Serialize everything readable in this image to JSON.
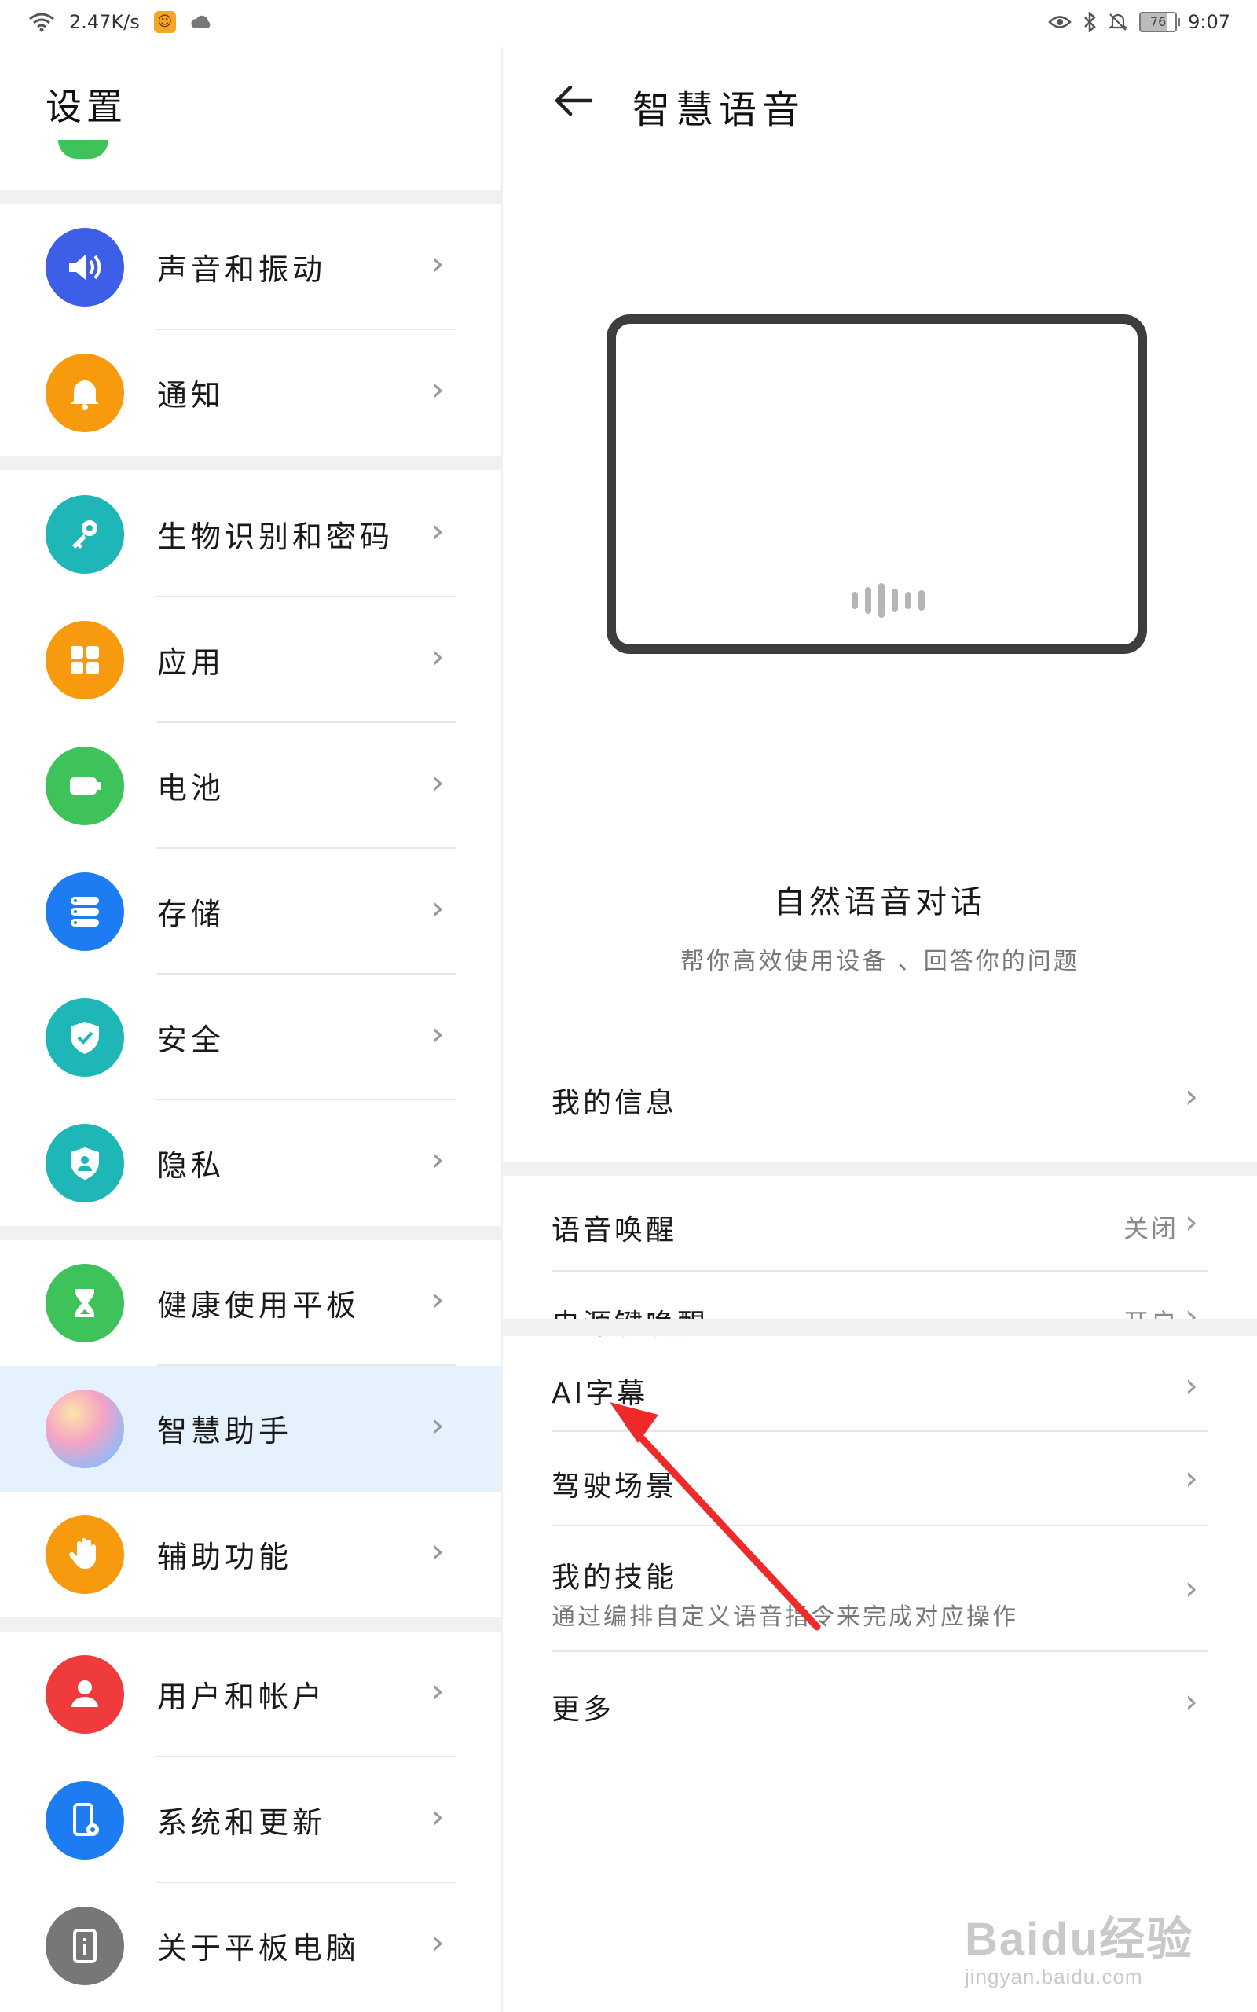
{
  "status_bar": {
    "speed": "2.47K/s",
    "battery": "76",
    "time": "9:07"
  },
  "left_pane": {
    "title": "设置",
    "items": [
      {
        "label": "声音和振动",
        "icon": "volume-icon",
        "color": "#3d5ee7"
      },
      {
        "label": "通知",
        "icon": "bell-icon",
        "color": "#f79a0e"
      },
      {
        "label": "生物识别和密码",
        "icon": "key-icon",
        "color": "#1fb6b8"
      },
      {
        "label": "应用",
        "icon": "apps-grid-icon",
        "color": "#f79a0e"
      },
      {
        "label": "电池",
        "icon": "battery-icon",
        "color": "#3ec25a"
      },
      {
        "label": "存储",
        "icon": "storage-icon",
        "color": "#1e7cf2"
      },
      {
        "label": "安全",
        "icon": "shield-check-icon",
        "color": "#1fb6b8"
      },
      {
        "label": "隐私",
        "icon": "privacy-shield-icon",
        "color": "#1fb6b8"
      },
      {
        "label": "健康使用平板",
        "icon": "hourglass-icon",
        "color": "#3ec25a"
      },
      {
        "label": "智慧助手",
        "icon": "assistant-orb-icon",
        "color": "#f4a3c4"
      },
      {
        "label": "辅助功能",
        "icon": "hand-icon",
        "color": "#f79a0e"
      },
      {
        "label": "用户和帐户",
        "icon": "user-icon",
        "color": "#ef3b3b"
      },
      {
        "label": "系统和更新",
        "icon": "phone-gear-icon",
        "color": "#1e7cf2"
      },
      {
        "label": "关于平板电脑",
        "icon": "tablet-info-icon",
        "color": "#777777"
      }
    ]
  },
  "right_pane": {
    "title": "智慧语音",
    "hero_title": "自然语音对话",
    "hero_subtitle": "帮你高效使用设备 、回答你的问题",
    "items": [
      {
        "label": "我的信息",
        "value": ""
      },
      {
        "label": "语音唤醒",
        "value": "关闭"
      },
      {
        "label": "电源键唤醒",
        "value": "开启"
      },
      {
        "label": "AI字幕",
        "value": ""
      },
      {
        "label": "驾驶场景",
        "value": ""
      },
      {
        "label": "我的技能",
        "subtitle": "通过编排自定义语音指令来完成对应操作",
        "value": ""
      },
      {
        "label": "更多",
        "value": ""
      }
    ]
  },
  "watermark": {
    "brand": "Baidu经验",
    "url": "jingyan.baidu.com"
  },
  "accent_color": "#e5f1fd",
  "annotation_color": "#ee2a2a"
}
